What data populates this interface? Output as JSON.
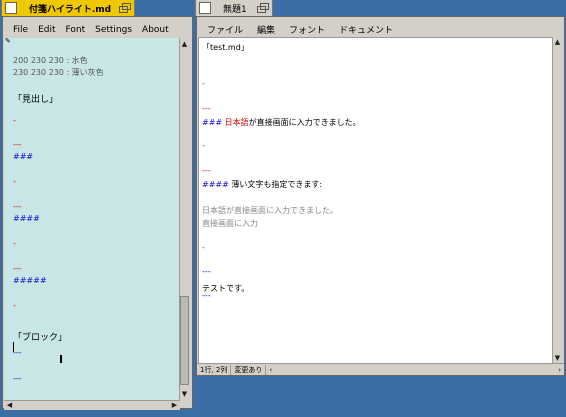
{
  "left": {
    "title": "付箋ハイライト.md",
    "menu": [
      "File",
      "Edit",
      "Font",
      "Settings",
      "About"
    ],
    "lines": [
      {
        "t": "200 230 230 : 水色",
        "c": "dim"
      },
      {
        "t": "230 230 230 : 薄い灰色",
        "c": "dim"
      },
      {
        "t": "「見出し」",
        "c": ""
      },
      {
        "t": "-",
        "c": "red"
      },
      {
        "t": "---",
        "c": "red"
      },
      {
        "t": "###",
        "c": "blue"
      },
      {
        "t": "-",
        "c": "red"
      },
      {
        "t": "---",
        "c": "red"
      },
      {
        "t": "####",
        "c": "blue"
      },
      {
        "t": "-",
        "c": "red"
      },
      {
        "t": "---",
        "c": "red"
      },
      {
        "t": "#####",
        "c": "blue"
      },
      {
        "t": "-",
        "c": "red"
      },
      {
        "t": "「ブロック」",
        "c": ""
      },
      {
        "t": "---",
        "c": "blue"
      },
      {
        "t": "---",
        "c": "blue"
      }
    ]
  },
  "right": {
    "title": "無題1",
    "menu": [
      "ファイル",
      "編集",
      "フォント",
      "ドキュメント"
    ],
    "line1": "「test.md」",
    "dash1": "-",
    "sep1": "---",
    "h3_hash": "###",
    "h3_red": "日本語",
    "h3_rest": "が直接画面に入力できました。",
    "dash2": "-",
    "sep2": "---",
    "h4_hash": "####",
    "h4_rest": "薄い文字も指定できます:",
    "gray1": "日本語が直接画面に入力できました。",
    "gray2": "直接画面に入力",
    "dash3": "-",
    "sep3": "---",
    "text": "テストです。",
    "sep4": "---",
    "status_pos": "1行, 2列",
    "status_mod": "変更あり"
  },
  "colors": {
    "left_tab": "#f0c800",
    "left_bg": "#c8e6e6",
    "right_bg": "#ffffff",
    "desktop": "#3a6ea5"
  }
}
